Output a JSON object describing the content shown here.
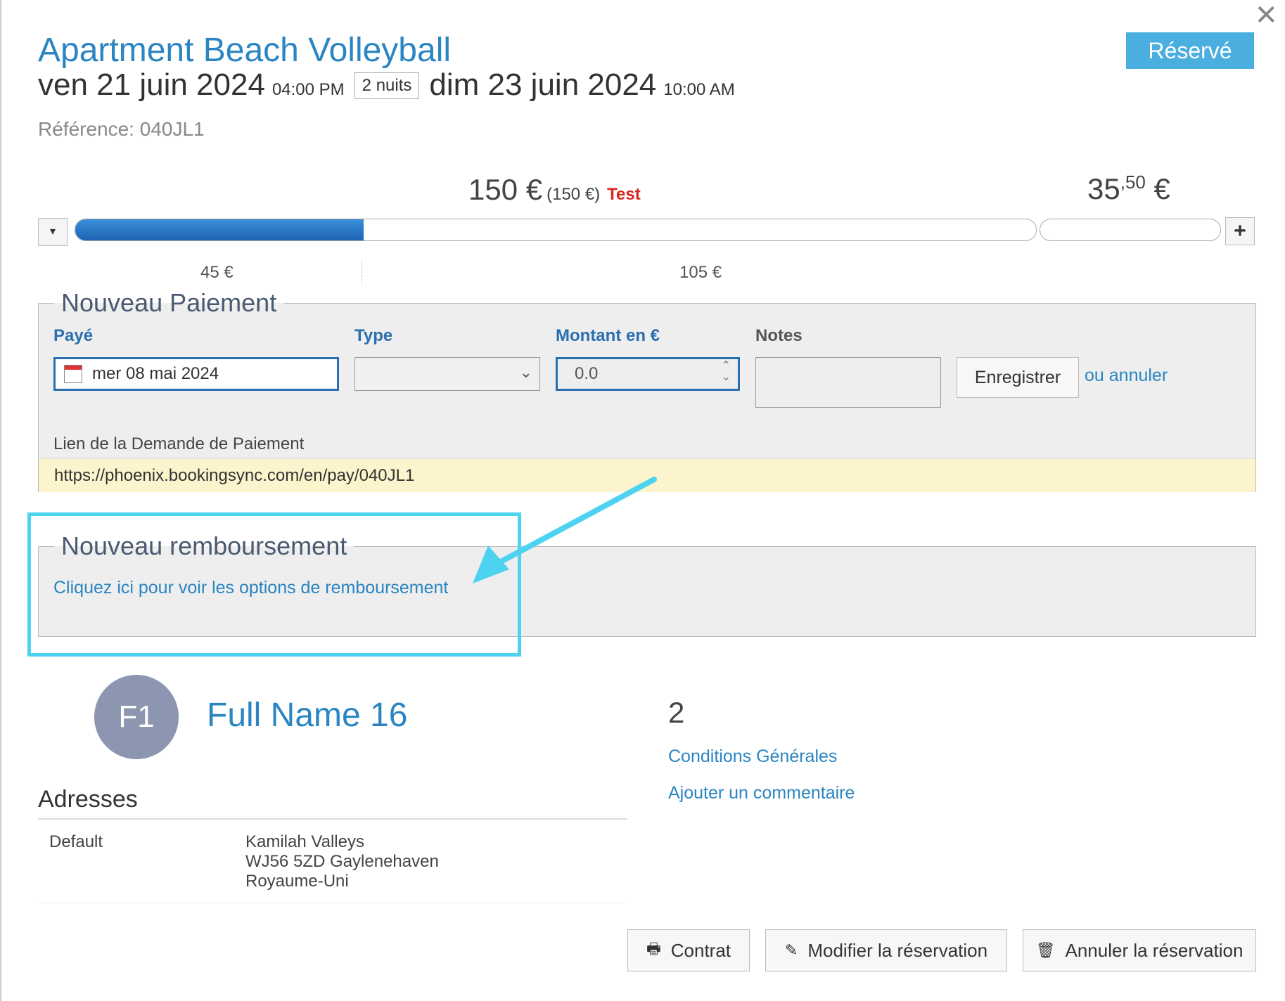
{
  "header": {
    "title": "Apartment Beach Volleyball",
    "status": "Réservé",
    "checkin_date": "ven 21 juin 2024",
    "checkin_time": "04:00 PM",
    "nights": "2 nuits",
    "checkout_date": "dim 23 juin 2024",
    "checkout_time": "10:00 AM",
    "reference": "Référence: 040JL1"
  },
  "price": {
    "total": "150 €",
    "total_paren": "(150 €)",
    "test_label": "Test",
    "right_amount_int": "35",
    "right_amount_dec": ",50",
    "right_currency": " €",
    "paid_portion": 0.3,
    "segment_paid": "45 €",
    "segment_remaining": "105 €"
  },
  "payment": {
    "legend": "Nouveau Paiement",
    "paid_label": "Payé",
    "type_label": "Type",
    "amount_label": "Montant en €",
    "notes_label": "Notes",
    "date_value": "mer 08 mai 2024",
    "amount_value": "0.0",
    "save_label": "Enregistrer",
    "or_text": "ou",
    "cancel_text": "annuler",
    "link_label": "Lien de la Demande de Paiement",
    "link_url": "https://phoenix.bookingsync.com/en/pay/040JL1"
  },
  "refund": {
    "legend": "Nouveau remboursement",
    "link_text": "Cliquez ici pour voir les options de remboursement"
  },
  "guest": {
    "initials": "F1",
    "name": "Full Name 16",
    "count": "2",
    "terms_link": "Conditions Générales",
    "comment_link": "Ajouter un commentaire"
  },
  "addresses": {
    "title": "Adresses",
    "kind": "Default",
    "line1": "Kamilah Valleys",
    "line2": "WJ56 5ZD Gaylenehaven",
    "line3": "Royaume-Uni"
  },
  "actions": {
    "contract": "Contrat",
    "edit": "Modifier la réservation",
    "cancel": "Annuler la réservation"
  },
  "colors": {
    "accent": "#2a85c2",
    "status_badge": "#4aaedf",
    "highlight": "#4dd3f0",
    "test_red": "#d9261c"
  }
}
